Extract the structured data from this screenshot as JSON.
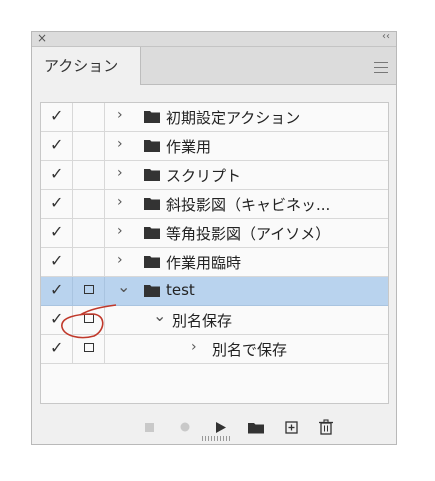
{
  "window": {
    "close_glyph": "×",
    "collapse_glyph": "‹‹"
  },
  "tab": {
    "label": "アクション"
  },
  "panel_menu_icon": "hamburger-icon",
  "colors": {
    "selected_row": "#b9d3ee",
    "annotation": "#c0392b"
  },
  "rows": [
    {
      "checked": true,
      "dialog": false,
      "expanded": false,
      "kind": "set",
      "label": "初期設定アクション"
    },
    {
      "checked": true,
      "dialog": false,
      "expanded": false,
      "kind": "set",
      "label": "作業用"
    },
    {
      "checked": true,
      "dialog": false,
      "expanded": false,
      "kind": "set",
      "label": "スクリプト"
    },
    {
      "checked": true,
      "dialog": false,
      "expanded": false,
      "kind": "set",
      "label": "斜投影図（キャビネッ..."
    },
    {
      "checked": true,
      "dialog": false,
      "expanded": false,
      "kind": "set",
      "label": "等角投影図（アイソメ）"
    },
    {
      "checked": true,
      "dialog": false,
      "expanded": false,
      "kind": "set",
      "label": "作業用臨時"
    },
    {
      "checked": true,
      "dialog": true,
      "expanded": true,
      "kind": "set",
      "label": "test",
      "selected": true
    },
    {
      "checked": true,
      "dialog": true,
      "expanded": true,
      "kind": "action",
      "label": "別名保存"
    },
    {
      "checked": true,
      "dialog": true,
      "expanded": false,
      "kind": "step",
      "label": "別名で保存"
    }
  ],
  "toolbar": [
    "stop-icon",
    "record-icon",
    "play-icon",
    "new-set-folder-icon",
    "new-action-icon",
    "delete-icon"
  ]
}
